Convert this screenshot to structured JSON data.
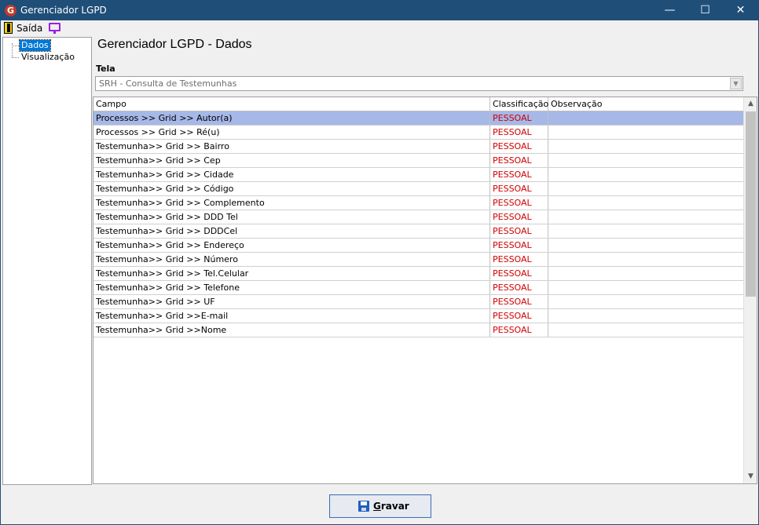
{
  "window": {
    "title": "Gerenciador LGPD",
    "minimize_glyph": "—",
    "maximize_glyph": "☐",
    "close_glyph": "✕"
  },
  "menu": {
    "exit_label": "Saída"
  },
  "tree": {
    "items": [
      {
        "label": "Dados",
        "selected": true
      },
      {
        "label": "Visualização",
        "selected": false
      }
    ]
  },
  "main": {
    "title": "Gerenciador LGPD - Dados",
    "tela_label": "Tela",
    "tela_value": "SRH - Consulta de Testemunhas"
  },
  "grid": {
    "columns": [
      "Campo",
      "Classificação",
      "Observação"
    ],
    "rows": [
      {
        "campo": "Processos >> Grid >> Autor(a)",
        "classificacao": "PESSOAL",
        "observacao": ""
      },
      {
        "campo": "Processos >> Grid >> Ré(u)",
        "classificacao": "PESSOAL",
        "observacao": ""
      },
      {
        "campo": "Testemunha>> Grid >> Bairro",
        "classificacao": "PESSOAL",
        "observacao": ""
      },
      {
        "campo": "Testemunha>> Grid >> Cep",
        "classificacao": "PESSOAL",
        "observacao": ""
      },
      {
        "campo": "Testemunha>> Grid >> Cidade",
        "classificacao": "PESSOAL",
        "observacao": ""
      },
      {
        "campo": "Testemunha>> Grid >> Código",
        "classificacao": "PESSOAL",
        "observacao": ""
      },
      {
        "campo": "Testemunha>> Grid >> Complemento",
        "classificacao": "PESSOAL",
        "observacao": ""
      },
      {
        "campo": "Testemunha>> Grid >> DDD Tel",
        "classificacao": "PESSOAL",
        "observacao": ""
      },
      {
        "campo": "Testemunha>> Grid >> DDDCel",
        "classificacao": "PESSOAL",
        "observacao": ""
      },
      {
        "campo": "Testemunha>> Grid >> Endereço",
        "classificacao": "PESSOAL",
        "observacao": ""
      },
      {
        "campo": "Testemunha>> Grid >> Número",
        "classificacao": "PESSOAL",
        "observacao": ""
      },
      {
        "campo": "Testemunha>> Grid >> Tel.Celular",
        "classificacao": "PESSOAL",
        "observacao": ""
      },
      {
        "campo": "Testemunha>> Grid >> Telefone",
        "classificacao": "PESSOAL",
        "observacao": ""
      },
      {
        "campo": "Testemunha>> Grid >> UF",
        "classificacao": "PESSOAL",
        "observacao": ""
      },
      {
        "campo": "Testemunha>> Grid >>E-mail",
        "classificacao": "PESSOAL",
        "observacao": ""
      },
      {
        "campo": "Testemunha>> Grid >>Nome",
        "classificacao": "PESSOAL",
        "observacao": ""
      }
    ],
    "selected_row": 0
  },
  "footer": {
    "save_label_first": "G",
    "save_label_rest": "ravar"
  },
  "colors": {
    "titlebar": "#1f4e79",
    "classification_text": "#d00000",
    "selected_row": "#a6b8e8",
    "tree_selection": "#0078d7"
  },
  "icons": {
    "app": "lgpd-app-icon",
    "exit": "exit-door-icon",
    "monitor": "monitor-icon",
    "save": "floppy-disk-icon"
  }
}
